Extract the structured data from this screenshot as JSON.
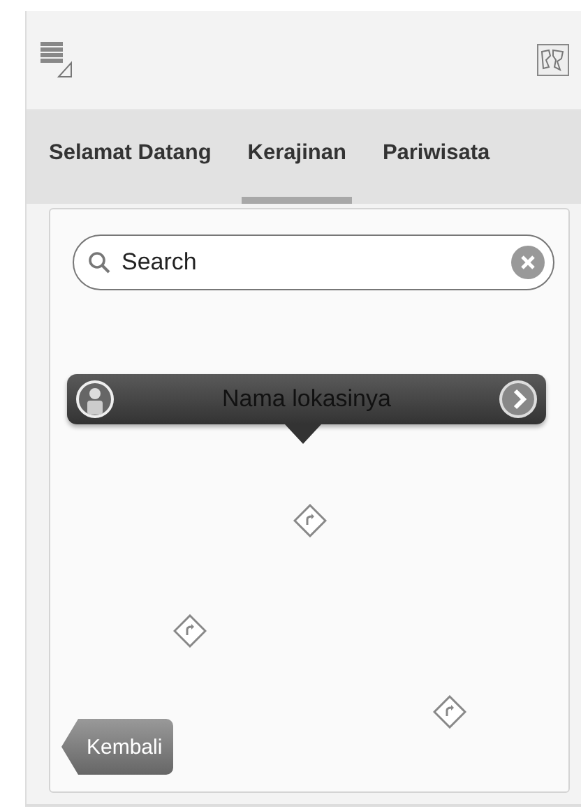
{
  "tabs": [
    {
      "label": "Selamat Datang",
      "selected": false
    },
    {
      "label": "Kerajinan",
      "selected": true
    },
    {
      "label": "Pariwisata",
      "selected": false
    }
  ],
  "search": {
    "placeholder": "Search"
  },
  "callout": {
    "title": "Nama lokasinya"
  },
  "back_button": {
    "label": "Kembali"
  }
}
